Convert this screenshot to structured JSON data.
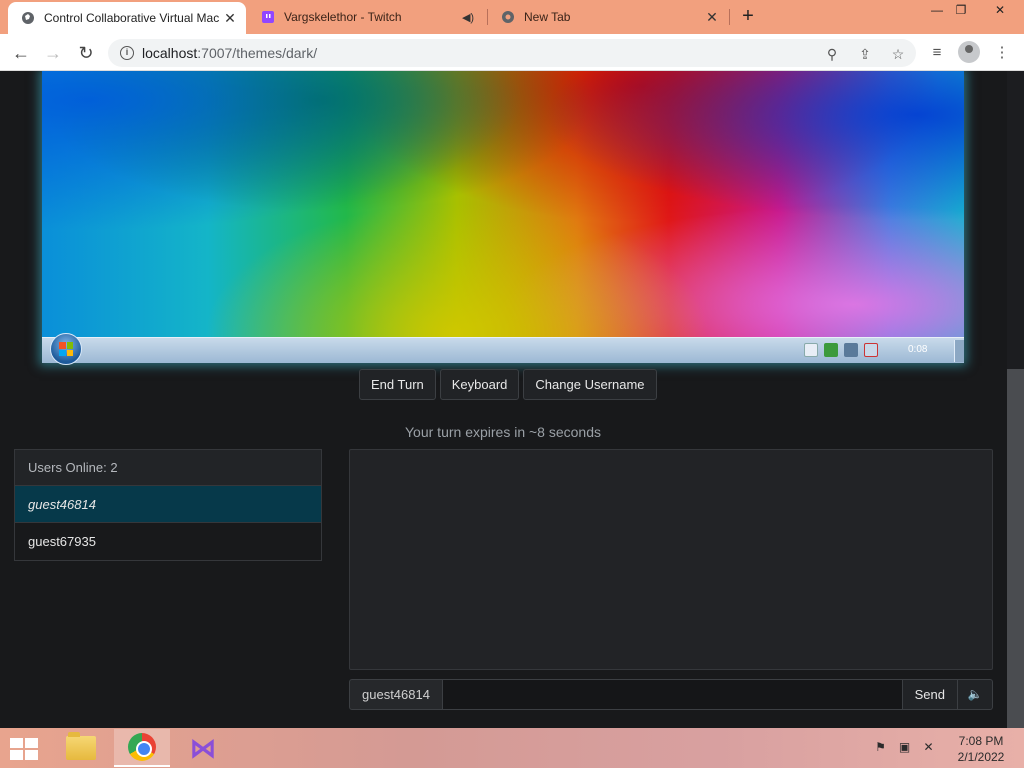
{
  "browser": {
    "tabs": [
      {
        "title": "Control Collaborative Virtual Mac",
        "favicon": "globe-icon",
        "active": true
      },
      {
        "title": "Vargskelethor - Twitch",
        "favicon": "twitch-icon",
        "active": false
      },
      {
        "title": "New Tab",
        "favicon": "chrome-icon",
        "active": false
      }
    ],
    "url_host": "localhost",
    "url_path": ":7007/themes/dark/"
  },
  "vm": {
    "clock": "0:08"
  },
  "controls": {
    "end_turn": "End Turn",
    "keyboard": "Keyboard",
    "change_username": "Change Username"
  },
  "turn_status": "Your turn expires in ~8 seconds",
  "users": {
    "header": "Users Online: 2",
    "list": [
      "guest46814",
      "guest67935"
    ]
  },
  "chat": {
    "username": "guest46814",
    "input_value": "",
    "send_label": "Send",
    "sound_icon": "speaker-icon"
  },
  "taskbar": {
    "time": "7:08 PM",
    "date": "2/1/2022"
  },
  "colors": {
    "page_bg": "#18191b",
    "selected_user": "#06394a",
    "tabstrip": "#f2a07e"
  }
}
